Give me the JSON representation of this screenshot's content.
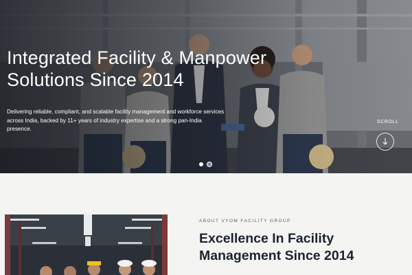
{
  "hero": {
    "title_line1": "Integrated Facility & Manpower",
    "title_line2": "Solutions Since 2014",
    "description": "Delivering reliable, compliant, and scalable facility management and workforce services across India, backed by 11+ years of industry expertise and a strong pan-India presence.",
    "scroll_label": "SCROLL",
    "scroll_icon": "arrow-down-icon",
    "slides": [
      {
        "active": false
      },
      {
        "active": true
      }
    ]
  },
  "about": {
    "eyebrow": "ABOUT VYOM FACILITY GROUP",
    "title_line1": "Excellence In Facility",
    "title_line2": "Management Since 2014"
  },
  "colors": {
    "page_background": "#f4f4f2",
    "hero_text": "#ffffff",
    "heading_dark": "#1c2330",
    "eyebrow_text": "#555a60"
  }
}
